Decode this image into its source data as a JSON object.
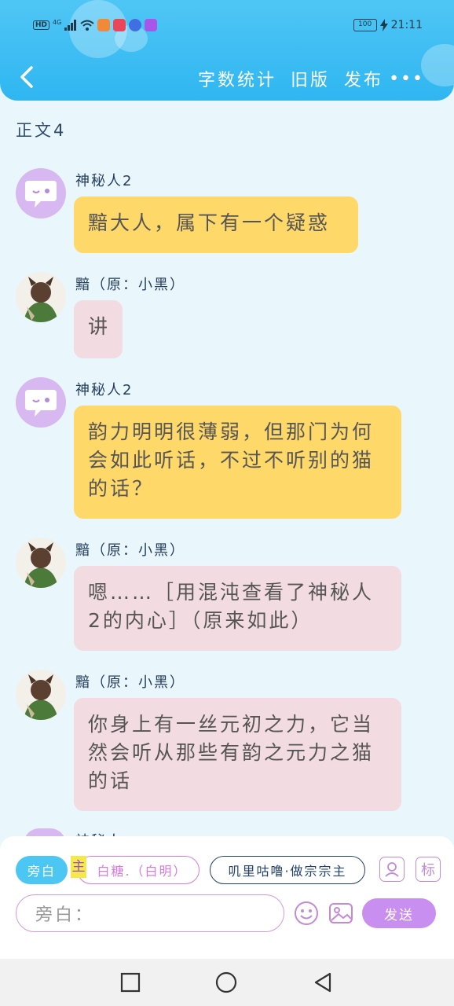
{
  "status_bar": {
    "hd_label": "HD",
    "network": "4G",
    "battery": "100",
    "time": "21:11"
  },
  "header": {
    "actions": [
      "字数统计",
      "旧版",
      "发布"
    ],
    "more": "•••"
  },
  "chapter_title": "正文4",
  "messages": [
    {
      "name": "神秘人2",
      "text": "黯大人，属下有一个疑惑"
    },
    {
      "name": "黯（原：小黑）",
      "text": "讲"
    },
    {
      "name": "神秘人2",
      "text": "韵力明明很薄弱，但那门为何会如此听话，不过不听别的猫的话？"
    },
    {
      "name": "黯（原：小黑）",
      "text": "嗯……［用混沌查看了神秘人2的内心］（原来如此）"
    },
    {
      "name": "黯（原：小黑）",
      "text": "你身上有一丝元初之力，它当然会听从那些有韵之元力之猫的话"
    }
  ],
  "peek_name": "神秘人",
  "composer": {
    "chip_aside": "旁白",
    "lead_tag": "主",
    "chip_lead": "白糖.（白明）",
    "chip_other": "叽里咕噜·做宗宗主",
    "tag_icon_label": "标",
    "input_placeholder": "旁白：",
    "send_label": "发送"
  },
  "colors": {
    "header": "#2fb6f1",
    "yellow_bubble": "#ffd86a",
    "pink_bubble": "#f2dbe1",
    "send": "#c98ff0"
  }
}
